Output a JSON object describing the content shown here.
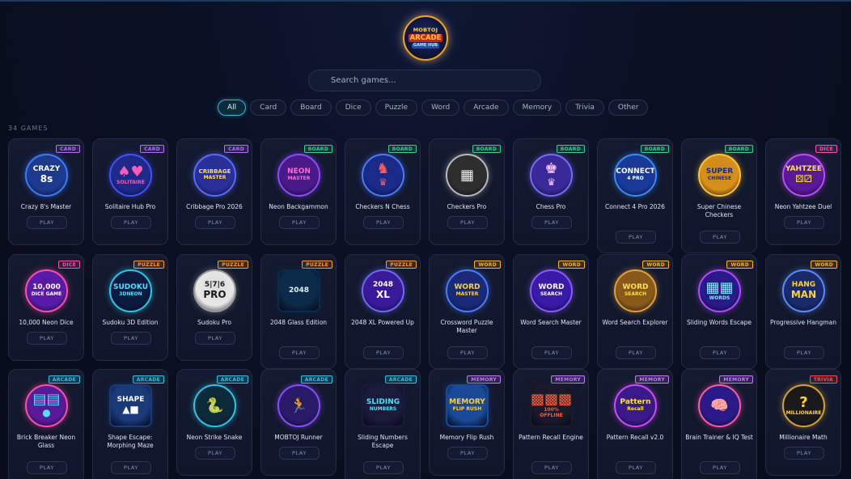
{
  "logo": {
    "line1": "MOBTOJ",
    "line2": "ARCADE",
    "line3": "GAME HUB"
  },
  "search": {
    "placeholder": "Search games..."
  },
  "filters": [
    "All",
    "Card",
    "Board",
    "Dice",
    "Puzzle",
    "Word",
    "Arcade",
    "Memory",
    "Trivia",
    "Other"
  ],
  "active_filter": "All",
  "count_label": "34 GAMES",
  "play_label": "PLAY",
  "category_colors": {
    "CARD": "#b46cff",
    "BOARD": "#36d08b",
    "DICE": "#ff4fa8",
    "PUZZLE": "#ff9a2e",
    "WORD": "#ffb320",
    "ARCADE": "#2ac8e8",
    "MEMORY": "#c87bff",
    "TRIVIA": "#ff4b4b"
  },
  "games": [
    {
      "name": "Crazy 8's Master",
      "category": "CARD",
      "icon": "crazy-eights-icon",
      "art": [
        "CRAZY",
        "8s"
      ],
      "bg": "#1d3b8f",
      "fg": "#ffffff",
      "ring": "#3c7bff"
    },
    {
      "name": "Solitaire Hub Pro",
      "category": "CARD",
      "icon": "solitaire-icon",
      "art": [
        "♠♥",
        "SOLITAIRE"
      ],
      "bg": "#1d2a8a",
      "fg": "#ff5ab5",
      "ring": "#4450ff"
    },
    {
      "name": "Cribbage Pro 2026",
      "category": "CARD",
      "icon": "cribbage-icon",
      "art": [
        "CRIBBAGE",
        "MASTER"
      ],
      "bg": "#2a2f9a",
      "fg": "#ffe14a",
      "ring": "#5a6bff"
    },
    {
      "name": "Neon Backgammon",
      "category": "BOARD",
      "icon": "backgammon-icon",
      "art": [
        "NEON",
        "MASTER"
      ],
      "bg": "#4a1a8a",
      "fg": "#ff6bd6",
      "ring": "#8c4bff"
    },
    {
      "name": "Checkers N Chess",
      "category": "BOARD",
      "icon": "checkers-chess-icon",
      "art": [
        "♞",
        "♛"
      ],
      "bg": "#1a2a8a",
      "fg": "#ff5a5a",
      "ring": "#4b7bff"
    },
    {
      "name": "Checkers Pro",
      "category": "BOARD",
      "icon": "checkers-board-icon",
      "art": [
        "▦",
        ""
      ],
      "bg": "#2e2e2e",
      "fg": "#f2f2f2",
      "ring": "#bbbbbb"
    },
    {
      "name": "Chess Pro",
      "category": "BOARD",
      "icon": "chess-icon",
      "art": [
        "♚",
        "♛"
      ],
      "bg": "#3a2a9a",
      "fg": "#ffc1f0",
      "ring": "#7a6bff"
    },
    {
      "name": "Connect 4 Pro 2026",
      "category": "BOARD",
      "icon": "connect-four-icon",
      "art": [
        "CONNECT",
        "4 PRO"
      ],
      "bg": "#1a3a9a",
      "fg": "#ffffff",
      "ring": "#3a8bff"
    },
    {
      "name": "Super Chinese Checkers",
      "category": "BOARD",
      "icon": "chinese-checkers-icon",
      "art": [
        "SUPER",
        "CHINESE"
      ],
      "bg": "#d8901a",
      "fg": "#1a2a8a",
      "ring": "#ffc23a"
    },
    {
      "name": "Neon Yahtzee Duel",
      "category": "DICE",
      "icon": "yahtzee-icon",
      "art": [
        "YAHTZEE",
        "⚄⚂"
      ],
      "bg": "#5a1a9a",
      "fg": "#ffe14a",
      "ring": "#c04bff"
    },
    {
      "name": "10,000 Neon Dice",
      "category": "DICE",
      "icon": "neon-dice-icon",
      "art": [
        "10,000",
        "DICE GAME"
      ],
      "bg": "#5a1aaa",
      "fg": "#ffffff",
      "ring": "#ff4fa8"
    },
    {
      "name": "Sudoku 3D Edition",
      "category": "PUZZLE",
      "icon": "sudoku-3d-icon",
      "art": [
        "SUDOKU",
        "3DNEON"
      ],
      "bg": "#0c1a40",
      "fg": "#4fe0ff",
      "ring": "#2ac8e8"
    },
    {
      "name": "Sudoku Pro",
      "category": "PUZZLE",
      "icon": "sudoku-grid-icon",
      "art": [
        "5|7|6",
        "PRO"
      ],
      "bg": "#e8e8e8",
      "fg": "#1a1a1a",
      "ring": "#999999"
    },
    {
      "name": "2048 Glass Edition",
      "category": "PUZZLE",
      "icon": "2048-glass-icon",
      "art": [
        "2048",
        ""
      ],
      "bg": "#0c2a4a",
      "fg": "#d8f2ff",
      "ring": "#0c2a4a"
    },
    {
      "name": "2048 XL Powered Up",
      "category": "PUZZLE",
      "icon": "2048-xl-icon",
      "art": [
        "2048",
        "XL"
      ],
      "bg": "#3a1a9a",
      "fg": "#ffffff",
      "ring": "#6a6bff"
    },
    {
      "name": "Crossword Puzzle Master",
      "category": "WORD",
      "icon": "crossword-icon",
      "art": [
        "WORD",
        "MASTER"
      ],
      "bg": "#1a2a7a",
      "fg": "#ffd23a",
      "ring": "#4a7bff"
    },
    {
      "name": "Word Search Master",
      "category": "WORD",
      "icon": "word-search-master-icon",
      "art": [
        "WORD",
        "SEARCH"
      ],
      "bg": "#3a1aaa",
      "fg": "#ffffff",
      "ring": "#8b5bff"
    },
    {
      "name": "Word Search Explorer",
      "category": "WORD",
      "icon": "word-search-explorer-icon",
      "art": [
        "WORD",
        "SEARCH"
      ],
      "bg": "#8a5a1a",
      "fg": "#ffe14a",
      "ring": "#e0a23a"
    },
    {
      "name": "Sliding Words Escape",
      "category": "WORD",
      "icon": "sliding-words-icon",
      "art": [
        "▦▦",
        "WORDS"
      ],
      "bg": "#2a1a8a",
      "fg": "#7bf0ff",
      "ring": "#b04bff"
    },
    {
      "name": "Progressive Hangman",
      "category": "WORD",
      "icon": "hangman-icon",
      "art": [
        "HANG",
        "MAN"
      ],
      "bg": "#1a2a6a",
      "fg": "#ffd23a",
      "ring": "#5a8bff"
    },
    {
      "name": "Brick Breaker Neon Glass",
      "category": "ARCADE",
      "icon": "brick-breaker-icon",
      "art": [
        "▤▤",
        "●"
      ],
      "bg": "#5a1a9a",
      "fg": "#4fe0ff",
      "ring": "#ff4fa8"
    },
    {
      "name": "Shape Escape: Morphing Maze",
      "category": "ARCADE",
      "icon": "shape-escape-icon",
      "art": [
        "SHAPE",
        "▲■"
      ],
      "bg": "#1a3a7a",
      "fg": "#ffffff",
      "ring": "#1a3a7a"
    },
    {
      "name": "Neon Strike Snake",
      "category": "ARCADE",
      "icon": "snake-icon",
      "art": [
        "🐍",
        ""
      ],
      "bg": "#0c2a3a",
      "fg": "#4fff8b",
      "ring": "#2ac8e8"
    },
    {
      "name": "MOBTOJ Runner",
      "category": "ARCADE",
      "icon": "runner-icon",
      "art": [
        "🏃",
        ""
      ],
      "bg": "#2a1a6a",
      "fg": "#4f9bff",
      "ring": "#8b4bff"
    },
    {
      "name": "Sliding Numbers Escape",
      "category": "ARCADE",
      "icon": "sliding-numbers-icon",
      "art": [
        "SLIDING",
        "NUMBERS"
      ],
      "bg": "#1a1a3a",
      "fg": "#4fe0ff",
      "ring": "#1a1a3a"
    },
    {
      "name": "Memory Flip Rush",
      "category": "MEMORY",
      "icon": "memory-flip-icon",
      "art": [
        "MEMORY",
        "FLIP RUSH"
      ],
      "bg": "#1a4a9a",
      "fg": "#ffd23a",
      "ring": "#1a4a9a"
    },
    {
      "name": "Pattern Recall Engine",
      "category": "MEMORY",
      "icon": "pattern-recall-engine-icon",
      "art": [
        "▩▩▩",
        "100% OFFLINE"
      ],
      "bg": "#1a1a2a",
      "fg": "#ff5a3a",
      "ring": "#1a1a2a"
    },
    {
      "name": "Pattern Recall v2.0",
      "category": "MEMORY",
      "icon": "pattern-recall-v2-icon",
      "art": [
        "Pattern",
        "Recall"
      ],
      "bg": "#3a1a8a",
      "fg": "#ffe14a",
      "ring": "#d04bff"
    },
    {
      "name": "Brain Trainer & IQ Test",
      "category": "MEMORY",
      "icon": "brain-trainer-icon",
      "art": [
        "🧠",
        ""
      ],
      "bg": "#2a1a8a",
      "fg": "#ff6bd6",
      "ring": "#ff5aa8"
    },
    {
      "name": "Millionaire Math",
      "category": "TRIVIA",
      "icon": "millionaire-icon",
      "art": [
        "?",
        "MILLIONAIRE"
      ],
      "bg": "#1a1a1a",
      "fg": "#ffd23a",
      "ring": "#d8a23a"
    }
  ]
}
